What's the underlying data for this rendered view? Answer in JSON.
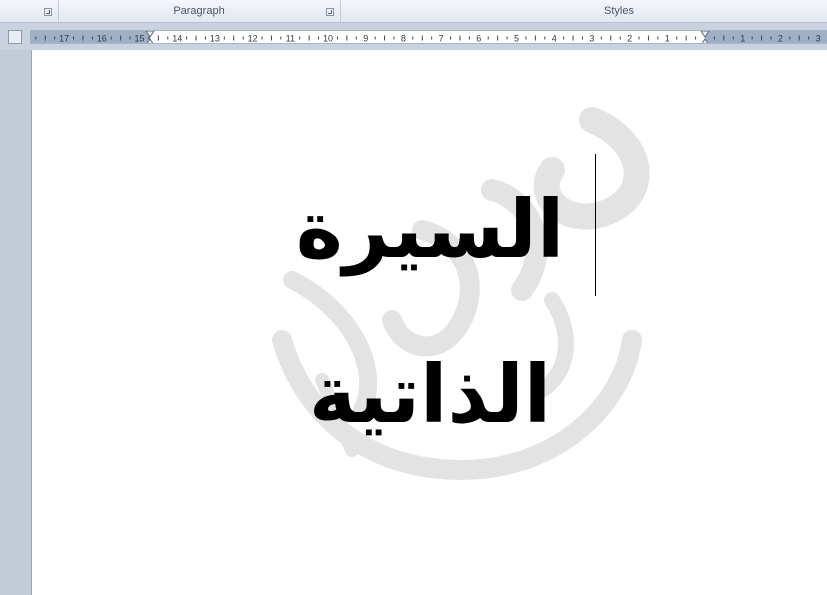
{
  "ribbon": {
    "groups": [
      {
        "label": "Paragraph"
      },
      {
        "label": "Styles"
      }
    ]
  },
  "ruler": {
    "left_labels": [
      "17",
      "16",
      "15",
      "14",
      "13",
      "12",
      "11",
      "10",
      "9",
      "8",
      "7",
      "6",
      "5",
      "4",
      "3",
      "2",
      "1"
    ],
    "right_labels": [
      "1",
      "2",
      "3"
    ]
  },
  "document": {
    "lines": [
      "السيرة",
      "الذاتية"
    ]
  },
  "colors": {
    "ribbon_bg": "#e2e8f1",
    "ruler_margin": "#9fb0c6",
    "page_bg": "#ffffff",
    "workspace_bg": "#c3cbd6",
    "watermark": "#e3e3e3"
  }
}
